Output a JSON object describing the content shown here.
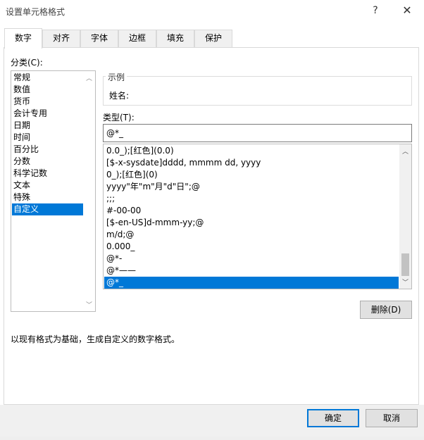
{
  "dialog": {
    "title": "设置单元格格式",
    "help_glyph": "?",
    "close_glyph": "✕"
  },
  "tabs": [
    {
      "label": "数字",
      "active": true
    },
    {
      "label": "对齐"
    },
    {
      "label": "字体"
    },
    {
      "label": "边框"
    },
    {
      "label": "填充"
    },
    {
      "label": "保护"
    }
  ],
  "category": {
    "label": "分类(C):",
    "items": [
      "常规",
      "数值",
      "货币",
      "会计专用",
      "日期",
      "时间",
      "百分比",
      "分数",
      "科学记数",
      "文本",
      "特殊",
      "自定义"
    ],
    "selected": "自定义"
  },
  "sample": {
    "legend": "示例",
    "value": "姓名:"
  },
  "type": {
    "label": "类型(T):",
    "value": "@*_",
    "formats": [
      "0.0_);[红色](0.0)",
      "[$-x-sysdate]dddd, mmmm dd, yyyy",
      "0_);[红色](0)",
      "yyyy\"年\"m\"月\"d\"日\";@",
      ";;;",
      "#-00-00",
      "[$-en-US]d-mmm-yy;@",
      "m/d;@",
      "0.000_",
      "@*-",
      "@*——",
      "@*_"
    ],
    "selected": "@*_"
  },
  "buttons": {
    "delete": "删除(D)",
    "ok": "确定",
    "cancel": "取消"
  },
  "description": "以现有格式为基础，生成自定义的数字格式。",
  "colors": {
    "selection": "#0078d7",
    "primary_border": "#0078d7"
  }
}
